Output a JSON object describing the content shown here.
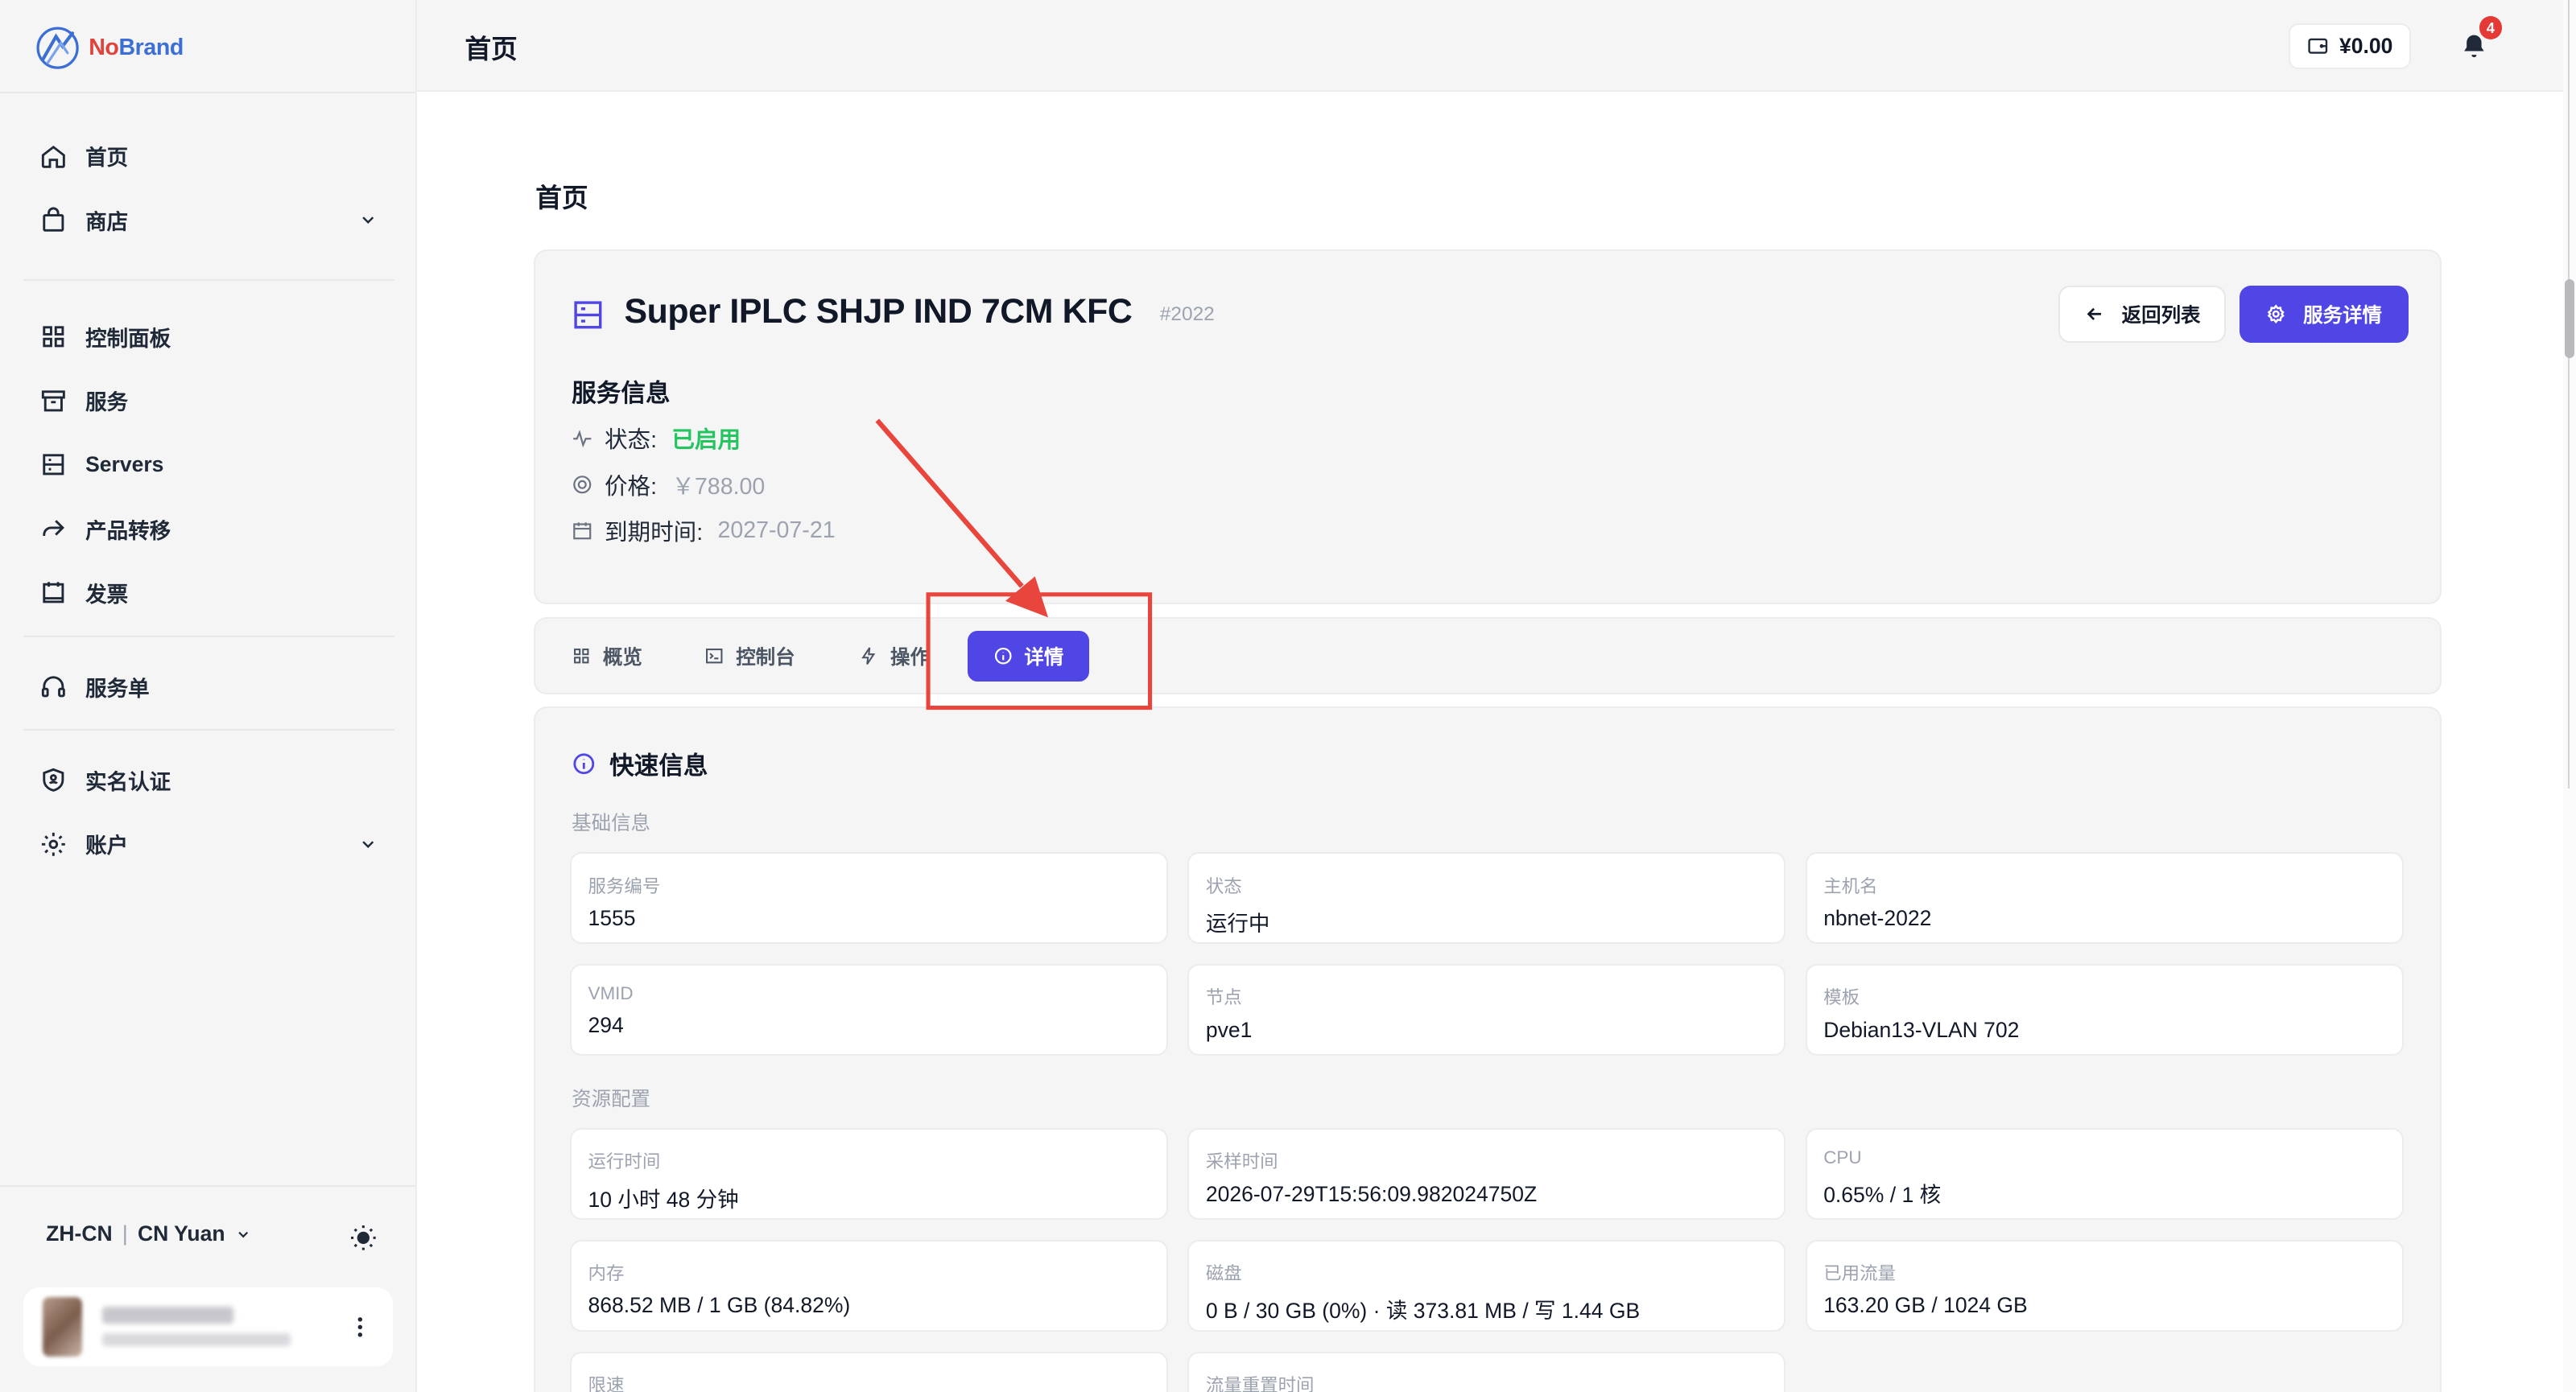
{
  "brand": {
    "name_prefix": "No",
    "name_suffix": "Brand"
  },
  "sidebar": {
    "items": [
      {
        "label": "首页",
        "icon": "home-icon"
      },
      {
        "label": "商店",
        "icon": "bag-icon",
        "expandable": true
      },
      {
        "label": "控制面板",
        "icon": "grid-icon"
      },
      {
        "label": "服务",
        "icon": "archive-icon"
      },
      {
        "label": "Servers",
        "icon": "server-icon"
      },
      {
        "label": "产品转移",
        "icon": "forward-icon"
      },
      {
        "label": "发票",
        "icon": "invoice-icon"
      },
      {
        "label": "服务单",
        "icon": "headset-icon"
      },
      {
        "label": "实名认证",
        "icon": "shield-icon"
      },
      {
        "label": "账户",
        "icon": "gear-icon",
        "expandable": true
      }
    ],
    "locale": "ZH-CN",
    "locale_sep": "|",
    "currency": "CN Yuan"
  },
  "topbar": {
    "title": "首页",
    "balance": "¥0.00",
    "notification_count": "4"
  },
  "page": {
    "title": "首页"
  },
  "service": {
    "name": "Super IPLC SHJP IND 7CM KFC",
    "id": "#2022",
    "back_label": "返回列表",
    "detail_label": "服务详情",
    "section_title": "服务信息",
    "status_label": "状态:",
    "status_value": "已启用",
    "price_label": "价格:",
    "price_value": "￥788.00",
    "expire_label": "到期时间:",
    "expire_value": "2027-07-21"
  },
  "tabs": [
    {
      "label": "概览",
      "icon": "grid-icon"
    },
    {
      "label": "控制台",
      "icon": "terminal-icon"
    },
    {
      "label": "操作",
      "icon": "bolt-icon"
    },
    {
      "label": "详情",
      "icon": "info-icon",
      "active": true
    }
  ],
  "quick_info": {
    "title": "快速信息",
    "basic_label": "基础信息",
    "resource_label": "资源配置",
    "basic": [
      {
        "key": "服务编号",
        "value": "1555"
      },
      {
        "key": "状态",
        "value": "运行中"
      },
      {
        "key": "主机名",
        "value": "nbnet-2022"
      },
      {
        "key": "VMID",
        "value": "294"
      },
      {
        "key": "节点",
        "value": "pve1"
      },
      {
        "key": "模板",
        "value": "Debian13-VLAN 702"
      }
    ],
    "resources": [
      {
        "key": "运行时间",
        "value": "10 小时 48 分钟"
      },
      {
        "key": "采样时间",
        "value": "2026-07-29T15:56:09.982024750Z"
      },
      {
        "key": "CPU",
        "value": "0.65% / 1 核"
      },
      {
        "key": "内存",
        "value": "868.52 MB / 1 GB (84.82%)"
      },
      {
        "key": "磁盘",
        "value": "0 B / 30 GB (0%) · 读 373.81 MB / 写 1.44 GB"
      },
      {
        "key": "已用流量",
        "value": "163.20 GB / 1024 GB"
      },
      {
        "key": "限速",
        "value": ""
      },
      {
        "key": "流量重置时间",
        "value": ""
      }
    ]
  },
  "colors": {
    "accent": "#5046e5",
    "status_green": "#22c55e",
    "annotation_red": "#e8453c",
    "badge_red": "#e53935"
  }
}
